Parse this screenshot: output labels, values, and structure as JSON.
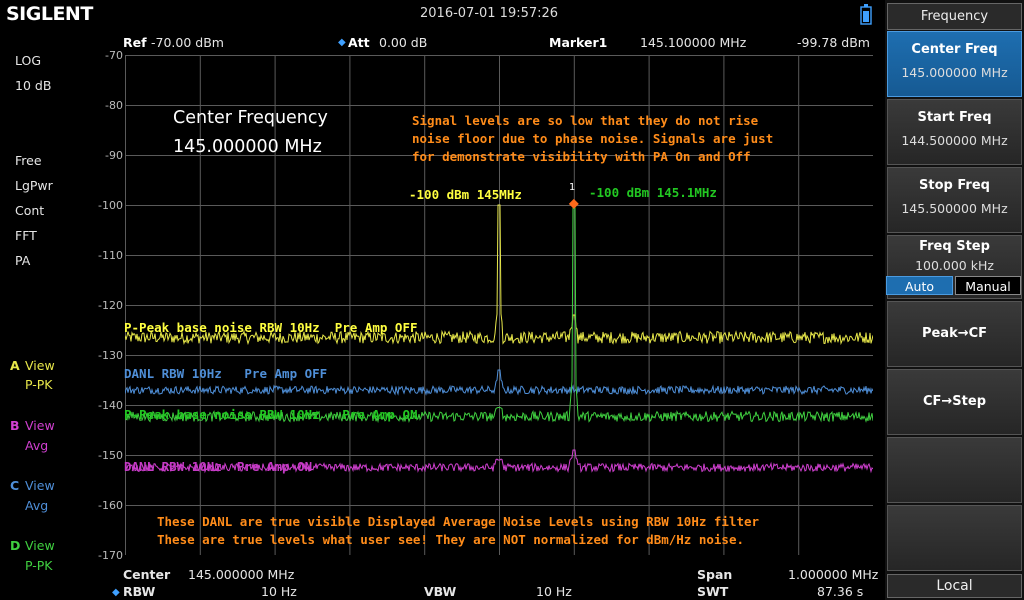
{
  "brand": "SIGLENT",
  "datetime": "2016-07-01   19:57:26",
  "left_status": [
    "LOG",
    "10 dB",
    "Free",
    "LgPwr",
    "Cont",
    "FFT",
    "PA"
  ],
  "traces": [
    {
      "letter": "A",
      "word": "View",
      "mode": "P-PK",
      "color": "#e8e84a"
    },
    {
      "letter": "B",
      "word": "View",
      "mode": "Avg",
      "color": "#d040d0"
    },
    {
      "letter": "C",
      "word": "View",
      "mode": "Avg",
      "color": "#4f8fd8"
    },
    {
      "letter": "D",
      "word": "View",
      "mode": "P-PK",
      "color": "#40d040"
    }
  ],
  "header": {
    "ref_label": "Ref",
    "ref_value": "-70.00 dBm",
    "att_label": "Att",
    "att_value": "0.00 dB",
    "marker_label": "Marker1",
    "marker_freq": "145.100000 MHz",
    "marker_level": "-99.78 dBm"
  },
  "y_axis": [
    "-70",
    "-80",
    "-90",
    "-100",
    "-110",
    "-120",
    "-130",
    "-140",
    "-150",
    "-160",
    "-170"
  ],
  "overlay": {
    "cf_title": "Center Frequency",
    "cf_value": "145.000000 MHz",
    "note_line1": "Signal levels are so low that they do not rise",
    "note_line2": "noise floor due to phase noise. Signals are just",
    "note_line3": "for demonstrate visibility with PA On and Off",
    "sig1": "-100 dBm 145MHz",
    "sig2": "-100 dBm 145.1MHz",
    "marker_num": "1",
    "label_a": "P-Peak base noise RBW 10Hz  Pre Amp OFF",
    "label_c": "DANL RBW 10Hz   Pre Amp OFF",
    "label_d": "P-Peak base noise RBW 10Hz   Pre Amp ON",
    "label_b": "DANL RBW 10Hz  Pre Amp ON",
    "bottom_note1": "These DANL are true visible Displayed Average Noise Levels using RBW 10Hz filter",
    "bottom_note2": "These are true levels what user see! They are NOT normalized for dBm/Hz noise."
  },
  "footer": {
    "center_label": "Center",
    "center_value": "145.000000 MHz",
    "span_label": "Span",
    "span_value": "1.000000 MHz",
    "rbw_label": "RBW",
    "rbw_value": "10 Hz",
    "vbw_label": "VBW",
    "vbw_value": "10 Hz",
    "swt_label": "SWT",
    "swt_value": "87.36 s"
  },
  "menu": {
    "title": "Frequency",
    "center_freq_label": "Center Freq",
    "center_freq_value": "145.000000 MHz",
    "start_freq_label": "Start Freq",
    "start_freq_value": "144.500000 MHz",
    "stop_freq_label": "Stop Freq",
    "stop_freq_value": "145.500000 MHz",
    "freq_step_label": "Freq Step",
    "freq_step_value": "100.000 kHz",
    "auto_label": "Auto",
    "manual_label": "Manual",
    "peak_cf_label": "Peak→CF",
    "cf_step_label": "CF→Step",
    "local_label": "Local"
  },
  "spectrum": {
    "ref_level": -70,
    "db_per_div": 10,
    "start_mhz": 144.5,
    "stop_mhz": 145.5,
    "traces": [
      {
        "name": "A",
        "base": -126.5,
        "noise": 1.2,
        "spike_mhz": [
          145.0,
          145.1
        ],
        "spike_levels": [
          -100,
          -122
        ],
        "color": "#e8e84a"
      },
      {
        "name": "C",
        "base": -137.0,
        "noise": 0.8,
        "spike_mhz": [
          145.0
        ],
        "spike_levels": [
          -133
        ],
        "color": "#4f8fd8"
      },
      {
        "name": "D",
        "base": -142.3,
        "noise": 1.0,
        "spike_mhz": [
          145.1,
          145.0
        ],
        "spike_levels": [
          -100,
          -140.5
        ],
        "color": "#40d040"
      },
      {
        "name": "B",
        "base": -152.5,
        "noise": 0.8,
        "spike_mhz": [
          145.1,
          145.0
        ],
        "spike_levels": [
          -149,
          -151
        ],
        "color": "#d040d0"
      }
    ],
    "marker_mhz": 145.1,
    "marker_level": -99.78
  },
  "colors": {
    "annotation": "#ff8c1a",
    "signal1": "#ffff40",
    "signal2": "#22c822",
    "grid": "#5a5a5a",
    "menu_selected": "#1e6eb0"
  }
}
